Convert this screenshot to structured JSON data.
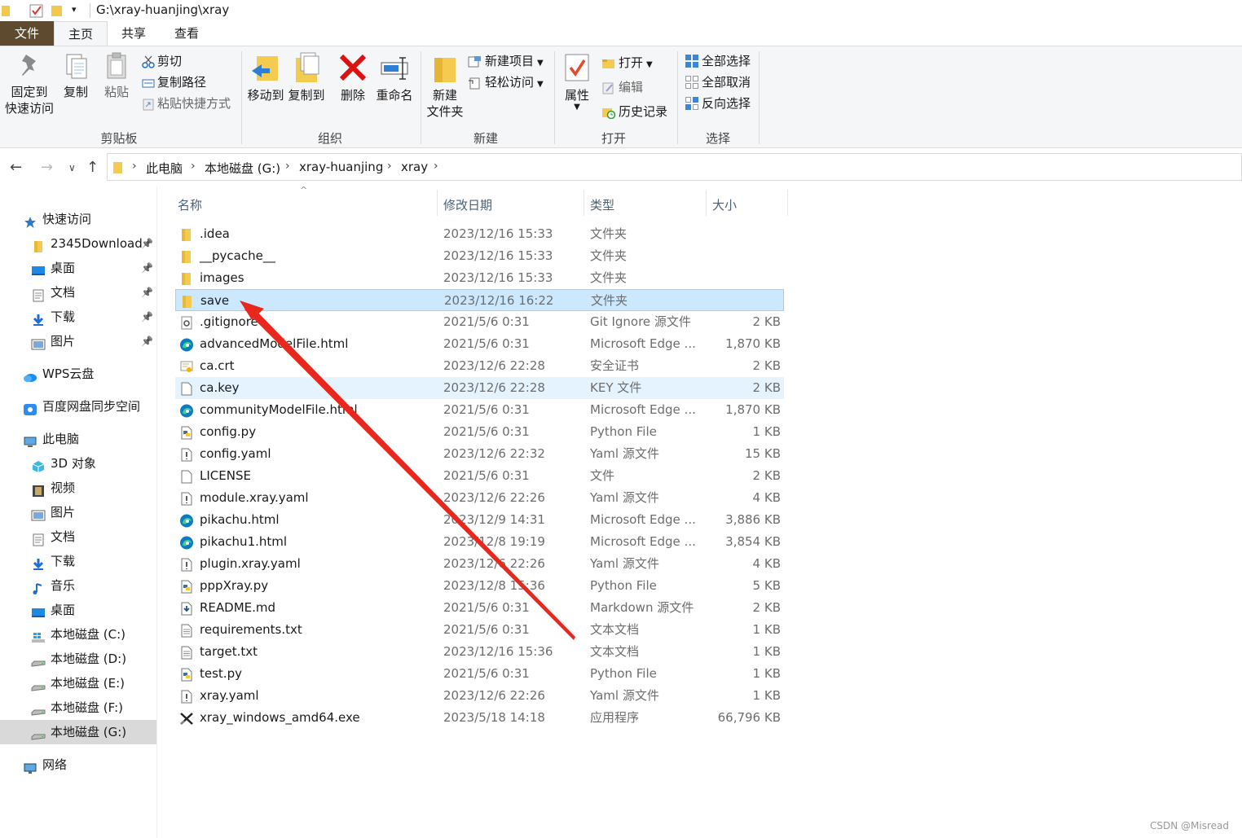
{
  "titlebar": {
    "path": "G:\\xray-huanjing\\xray"
  },
  "tabs": {
    "file": "文件",
    "home": "主页",
    "share": "共享",
    "view": "查看"
  },
  "ribbon": {
    "clipboard": {
      "label": "剪贴板",
      "pin_line1": "固定到",
      "pin_line2": "快速访问",
      "copy": "复制",
      "paste": "粘贴",
      "cut": "剪切",
      "copy_path": "复制路径",
      "paste_shortcut": "粘贴快捷方式"
    },
    "organize": {
      "label": "组织",
      "move_to": "移动到",
      "copy_to": "复制到",
      "delete": "删除",
      "rename": "重命名"
    },
    "new": {
      "label": "新建",
      "new_folder_line1": "新建",
      "new_folder_line2": "文件夹",
      "new_item": "新建项目",
      "easy_access": "轻松访问"
    },
    "open": {
      "label": "打开",
      "properties": "属性",
      "open": "打开",
      "edit": "编辑",
      "history": "历史记录"
    },
    "select": {
      "label": "选择",
      "select_all": "全部选择",
      "select_none": "全部取消",
      "invert": "反向选择"
    }
  },
  "breadcrumb": [
    "此电脑",
    "本地磁盘 (G:)",
    "xray-huanjing",
    "xray"
  ],
  "nav": [
    {
      "label": "快速访问",
      "icon": "star-icon",
      "level": 0
    },
    {
      "label": "2345Download",
      "icon": "folder-icon",
      "level": 1,
      "pinned": true
    },
    {
      "label": "桌面",
      "icon": "desktop-icon",
      "level": 1,
      "pinned": true
    },
    {
      "label": "文档",
      "icon": "document-icon",
      "level": 1,
      "pinned": true
    },
    {
      "label": "下载",
      "icon": "download-icon",
      "level": 1,
      "pinned": true
    },
    {
      "label": "图片",
      "icon": "picture-icon",
      "level": 1,
      "pinned": true
    },
    {
      "label": "WPS云盘",
      "icon": "cloud-icon",
      "level": 0
    },
    {
      "label": "百度网盘同步空间",
      "icon": "baidu-icon",
      "level": 0
    },
    {
      "label": "此电脑",
      "icon": "computer-icon",
      "level": 0
    },
    {
      "label": "3D 对象",
      "icon": "cube-icon",
      "level": 1
    },
    {
      "label": "视频",
      "icon": "video-icon",
      "level": 1
    },
    {
      "label": "图片",
      "icon": "picture-icon",
      "level": 1
    },
    {
      "label": "文档",
      "icon": "document-icon",
      "level": 1
    },
    {
      "label": "下载",
      "icon": "download-icon",
      "level": 1
    },
    {
      "label": "音乐",
      "icon": "music-icon",
      "level": 1
    },
    {
      "label": "桌面",
      "icon": "desktop-icon",
      "level": 1
    },
    {
      "label": "本地磁盘 (C:)",
      "icon": "windows-drive-icon",
      "level": 1
    },
    {
      "label": "本地磁盘 (D:)",
      "icon": "drive-icon",
      "level": 1
    },
    {
      "label": "本地磁盘 (E:)",
      "icon": "drive-icon",
      "level": 1
    },
    {
      "label": "本地磁盘 (F:)",
      "icon": "drive-icon",
      "level": 1
    },
    {
      "label": "本地磁盘 (G:)",
      "icon": "drive-icon",
      "level": 1,
      "selected": true
    },
    {
      "label": "网络",
      "icon": "network-icon",
      "level": 0
    }
  ],
  "columns": {
    "name": "名称",
    "modified": "修改日期",
    "type": "类型",
    "size": "大小"
  },
  "files": [
    {
      "name": ".idea",
      "date": "2023/12/16 15:33",
      "type": "文件夹",
      "size": "",
      "icon": "folder-icon"
    },
    {
      "name": "__pycache__",
      "date": "2023/12/16 15:33",
      "type": "文件夹",
      "size": "",
      "icon": "folder-icon"
    },
    {
      "name": "images",
      "date": "2023/12/16 15:33",
      "type": "文件夹",
      "size": "",
      "icon": "folder-icon"
    },
    {
      "name": "save",
      "date": "2023/12/16 16:22",
      "type": "文件夹",
      "size": "",
      "icon": "folder-icon",
      "state": "selected"
    },
    {
      "name": ".gitignore",
      "date": "2021/5/6 0:31",
      "type": "Git Ignore 源文件",
      "size": "2 KB",
      "icon": "gear-file-icon"
    },
    {
      "name": "advancedModelFile.html",
      "date": "2021/5/6 0:31",
      "type": "Microsoft Edge ...",
      "size": "1,870 KB",
      "icon": "edge-icon"
    },
    {
      "name": "ca.crt",
      "date": "2023/12/6 22:28",
      "type": "安全证书",
      "size": "2 KB",
      "icon": "certificate-icon"
    },
    {
      "name": "ca.key",
      "date": "2023/12/6 22:28",
      "type": "KEY 文件",
      "size": "2 KB",
      "icon": "blank-file-icon",
      "state": "hover"
    },
    {
      "name": "communityModelFile.html",
      "date": "2021/5/6 0:31",
      "type": "Microsoft Edge ...",
      "size": "1,870 KB",
      "icon": "edge-icon"
    },
    {
      "name": "config.py",
      "date": "2021/5/6 0:31",
      "type": "Python File",
      "size": "1 KB",
      "icon": "python-file-icon"
    },
    {
      "name": "config.yaml",
      "date": "2023/12/6 22:32",
      "type": "Yaml 源文件",
      "size": "15 KB",
      "icon": "yaml-file-icon"
    },
    {
      "name": "LICENSE",
      "date": "2021/5/6 0:31",
      "type": "文件",
      "size": "2 KB",
      "icon": "blank-file-icon"
    },
    {
      "name": "module.xray.yaml",
      "date": "2023/12/6 22:26",
      "type": "Yaml 源文件",
      "size": "4 KB",
      "icon": "yaml-file-icon"
    },
    {
      "name": "pikachu.html",
      "date": "2023/12/9 14:31",
      "type": "Microsoft Edge ...",
      "size": "3,886 KB",
      "icon": "edge-icon"
    },
    {
      "name": "pikachu1.html",
      "date": "2023/12/8 19:19",
      "type": "Microsoft Edge ...",
      "size": "3,854 KB",
      "icon": "edge-icon"
    },
    {
      "name": "plugin.xray.yaml",
      "date": "2023/12/6 22:26",
      "type": "Yaml 源文件",
      "size": "4 KB",
      "icon": "yaml-file-icon"
    },
    {
      "name": "pppXray.py",
      "date": "2023/12/8 15:36",
      "type": "Python File",
      "size": "5 KB",
      "icon": "python-file-icon"
    },
    {
      "name": "README.md",
      "date": "2021/5/6 0:31",
      "type": "Markdown 源文件",
      "size": "2 KB",
      "icon": "markdown-file-icon"
    },
    {
      "name": "requirements.txt",
      "date": "2021/5/6 0:31",
      "type": "文本文档",
      "size": "1 KB",
      "icon": "text-file-icon"
    },
    {
      "name": "target.txt",
      "date": "2023/12/16 15:36",
      "type": "文本文档",
      "size": "1 KB",
      "icon": "text-file-icon"
    },
    {
      "name": "test.py",
      "date": "2021/5/6 0:31",
      "type": "Python File",
      "size": "1 KB",
      "icon": "python-file-icon"
    },
    {
      "name": "xray.yaml",
      "date": "2023/12/6 22:26",
      "type": "Yaml 源文件",
      "size": "1 KB",
      "icon": "yaml-file-icon"
    },
    {
      "name": "xray_windows_amd64.exe",
      "date": "2023/5/18 14:18",
      "type": "应用程序",
      "size": "66,796 KB",
      "icon": "exe-icon"
    }
  ],
  "watermark": "CSDN @Misread",
  "colors": {
    "accent_file_tab": "#5d4a2f",
    "selection": "#cce8ff",
    "arrow": "#e8271d"
  }
}
